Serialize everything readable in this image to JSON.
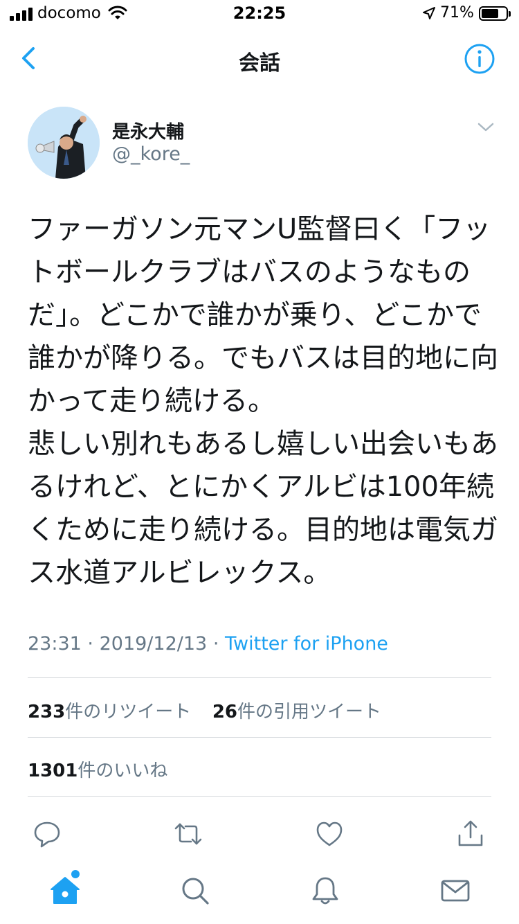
{
  "status_bar": {
    "carrier": "docomo",
    "time": "22:25",
    "battery_percent": "71%",
    "battery_level": 0.71,
    "icons": [
      "signal-icon",
      "wifi-icon",
      "location-arrow-icon",
      "battery-icon"
    ]
  },
  "nav": {
    "title": "会話",
    "back_icon": "chevron-left-icon",
    "info_icon": "info-icon"
  },
  "author": {
    "name": "是永大輔",
    "handle": "@_kore_"
  },
  "tweet": {
    "text": "ファーガソン元マンU監督曰く「フットボールクラブはバスのようなものだ」。どこかで誰かが乗り、どこかで誰かが降りる。でもバスは目的地に向かって走り続ける。\n悲しい別れもあるし嬉しい出会いもあるけれど、とにかくアルビは100年続くために走り続ける。目的地は電気ガス水道アルビレックス。",
    "time": "23:31",
    "date": "2019/12/13",
    "separator": "·",
    "source": "Twitter for iPhone"
  },
  "stats": {
    "retweets_count": "233",
    "retweets_label": "件のリツイート",
    "quotes_count": "26",
    "quotes_label": "件の引用ツイート",
    "likes_count": "1301",
    "likes_label": "件のいいね"
  },
  "actions": [
    "reply-icon",
    "retweet-icon",
    "like-icon",
    "share-icon"
  ],
  "tabs": [
    "home-icon",
    "search-icon",
    "notifications-icon",
    "messages-icon"
  ],
  "colors": {
    "accent": "#1da1f2",
    "text": "#14171a",
    "secondary": "#657786",
    "divider": "#d5d9dc"
  }
}
